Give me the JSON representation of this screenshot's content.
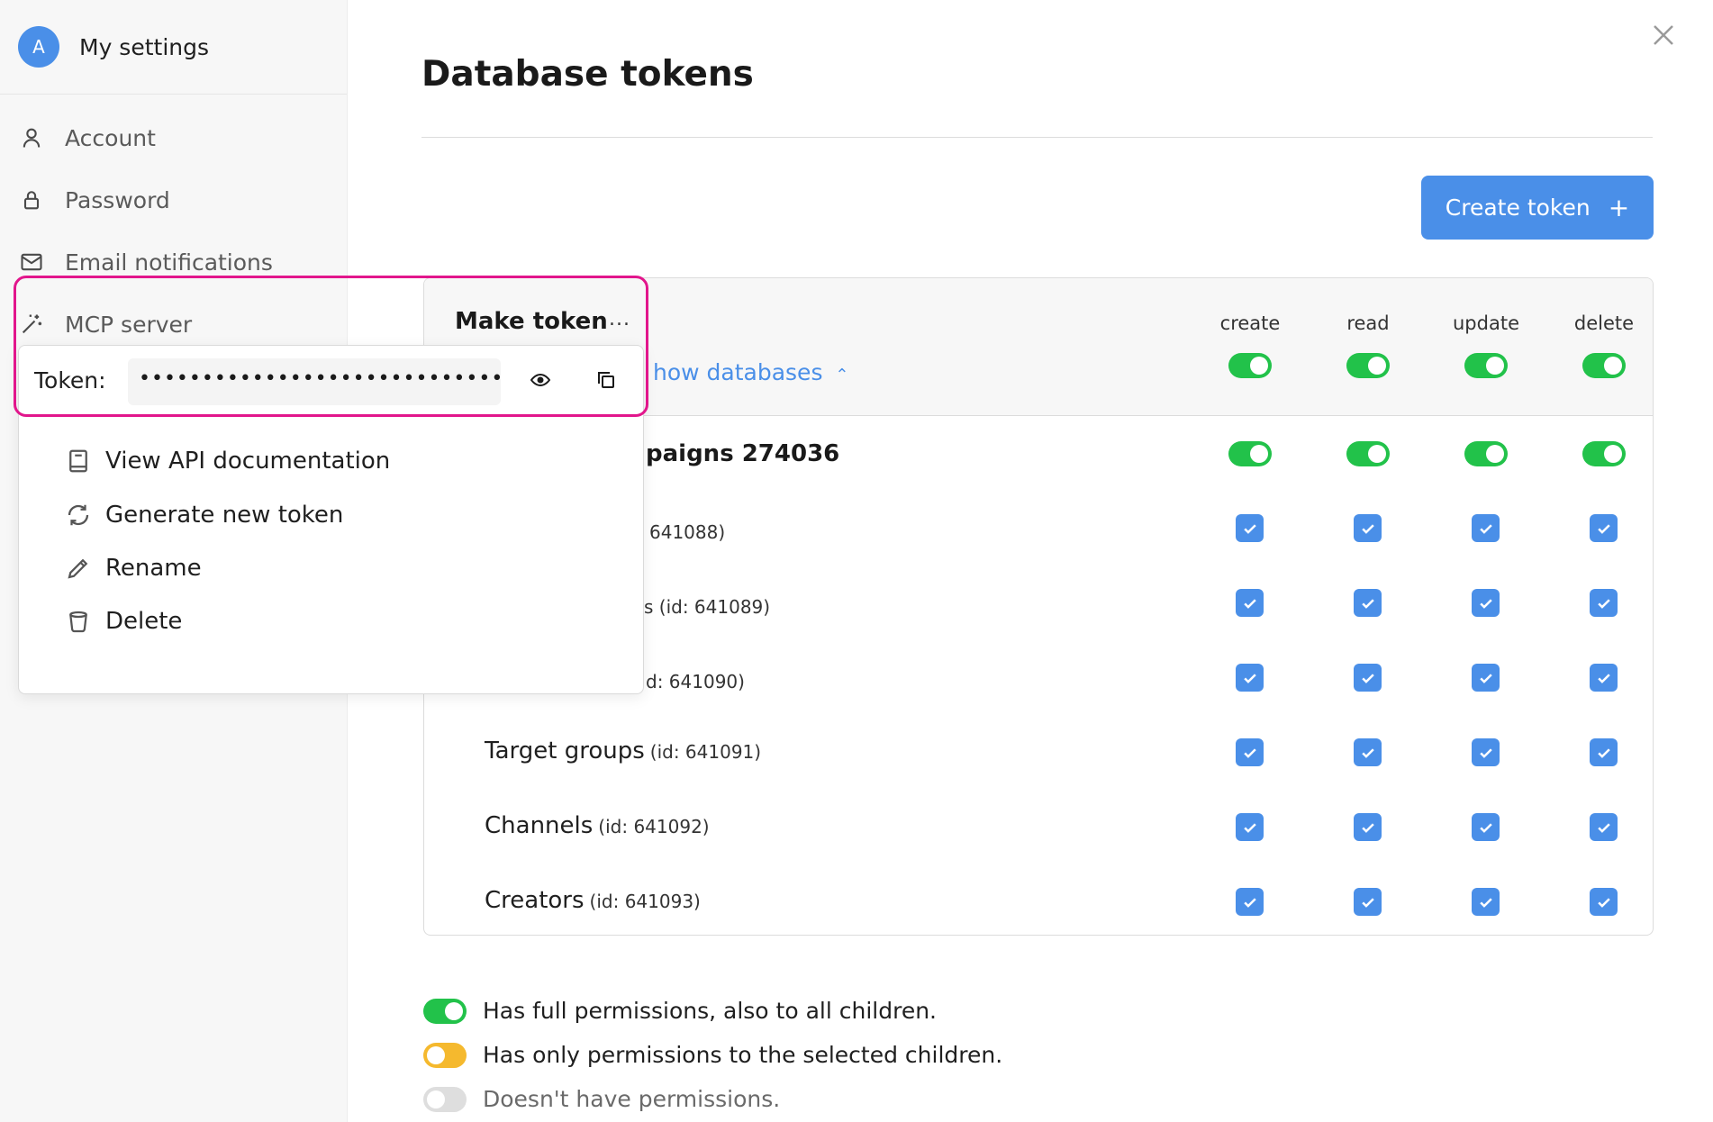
{
  "sidebar": {
    "avatar_letter": "A",
    "title": "My settings",
    "items": [
      {
        "label": "Account",
        "icon": "user-icon"
      },
      {
        "label": "Password",
        "icon": "lock-icon"
      },
      {
        "label": "Email notifications",
        "icon": "mail-icon"
      },
      {
        "label": "MCP server",
        "icon": "magic-wand-icon"
      }
    ]
  },
  "main": {
    "title": "Database tokens",
    "create_button": {
      "label": "Create token",
      "icon": "plus-icon"
    },
    "show_databases_label": "how databases",
    "columns": [
      "create",
      "read",
      "update",
      "delete"
    ],
    "database_name_fragment": "paigns 274036",
    "rows": [
      {
        "name": "",
        "fragment": "641088)"
      },
      {
        "name": "",
        "fragment": "s (id: 641089)"
      },
      {
        "name": "",
        "fragment": "d: 641090)"
      },
      {
        "name": "Target groups",
        "id": "(id: 641091)"
      },
      {
        "name": "Channels",
        "id": "(id: 641092)"
      },
      {
        "name": "Creators",
        "id": "(id: 641093)"
      }
    ],
    "legend": [
      {
        "text": "Has full permissions, also to all children.",
        "state": "full"
      },
      {
        "text": "Has only permissions to the selected children.",
        "state": "partial"
      },
      {
        "text": "Doesn't have permissions.",
        "state": "none"
      }
    ]
  },
  "popup": {
    "token_name": "Make token",
    "more_label": "...",
    "token_label": "Token:",
    "token_value": "••••••••••••••••••••••••••••••",
    "menu": [
      {
        "label": "View API documentation",
        "icon": "book-icon"
      },
      {
        "label": "Generate new token",
        "icon": "refresh-icon"
      },
      {
        "label": "Rename",
        "icon": "pencil-icon"
      },
      {
        "label": "Delete",
        "icon": "trash-icon"
      }
    ]
  },
  "colors": {
    "accent": "#4a8fe8",
    "green": "#22c24a",
    "yellow": "#f5b92e",
    "highlight": "#e2168c"
  }
}
